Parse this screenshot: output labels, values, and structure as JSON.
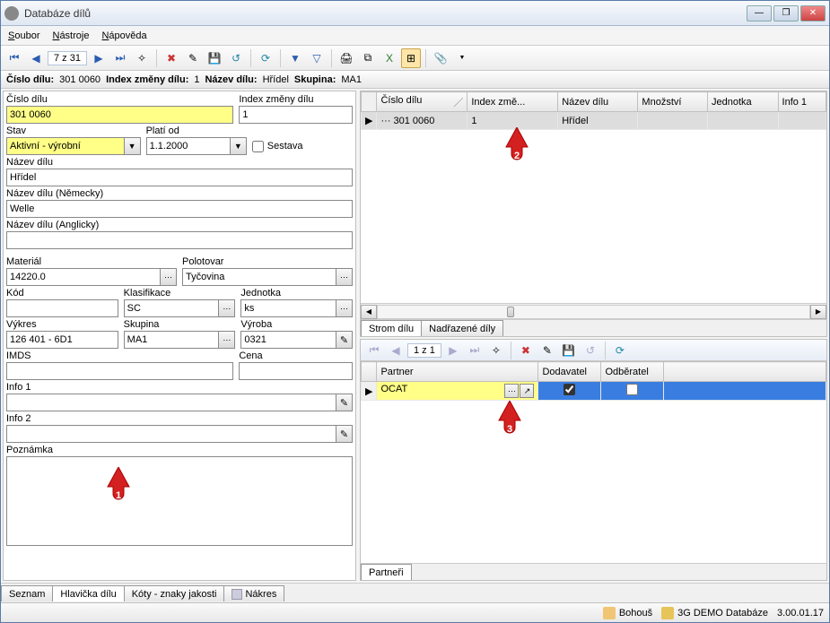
{
  "window": {
    "title": "Databáze dílů"
  },
  "menubar": {
    "soubor": "Soubor",
    "nastroje": "Nástroje",
    "napoveda": "Nápověda"
  },
  "toolbar": {
    "nav_count": "7 z 31"
  },
  "infobar": {
    "cislo_dilu_lbl": "Číslo dílu:",
    "cislo_dilu_val": "301 0060",
    "index_lbl": "Index změny dílu:",
    "index_val": "1",
    "nazev_lbl": "Název dílu:",
    "nazev_val": "Hřídel",
    "skupina_lbl": "Skupina:",
    "skupina_val": "MA1"
  },
  "form": {
    "cislo_dilu_lbl": "Číslo dílu",
    "cislo_dilu": "301 0060",
    "index_lbl": "Index změny dílu",
    "index": "1",
    "stav_lbl": "Stav",
    "stav": "Aktivní - výrobní",
    "plati_od_lbl": "Platí od",
    "plati_od": "1.1.2000",
    "sestava_lbl": "Sestava",
    "nazev_lbl": "Název dílu",
    "nazev": "Hřídel",
    "nazev_de_lbl": "Název dílu (Německy)",
    "nazev_de": "Welle",
    "nazev_en_lbl": "Název dílu (Anglicky)",
    "nazev_en": "",
    "material_lbl": "Materiál",
    "material": "14220.0",
    "polotovar_lbl": "Polotovar",
    "polotovar": "Tyčovina",
    "kod_lbl": "Kód",
    "kod": "",
    "klasifikace_lbl": "Klasifikace",
    "klasifikace": "SC",
    "jednotka_lbl": "Jednotka",
    "jednotka": "ks",
    "vykres_lbl": "Výkres",
    "vykres": "126 401 - 6D1",
    "skupina_lbl": "Skupina",
    "skupina": "MA1",
    "vyroba_lbl": "Výroba",
    "vyroba": "0321",
    "imds_lbl": "IMDS",
    "imds": "",
    "cena_lbl": "Cena",
    "cena": "",
    "info1_lbl": "Info 1",
    "info1": "",
    "info2_lbl": "Info 2",
    "info2": "",
    "poznamka_lbl": "Poznámka",
    "poznamka": ""
  },
  "tree_grid": {
    "cols": {
      "cislo": "Číslo dílu",
      "index": "Index změ...",
      "nazev": "Název dílu",
      "mnozstvi": "Množství",
      "jednotka": "Jednotka",
      "info1": "Info 1"
    },
    "row": {
      "cislo": "··· 301 0060",
      "index": "1",
      "nazev": "Hřídel",
      "mnozstvi": "",
      "jednotka": "",
      "info1": ""
    }
  },
  "tree_tabs": {
    "strom": "Strom dílu",
    "nadrazene": "Nadřazené díly"
  },
  "partners": {
    "nav_count": "1 z 1",
    "cols": {
      "partner": "Partner",
      "dodavatel": "Dodavatel",
      "odberatel": "Odběratel"
    },
    "row": {
      "partner": "OCAT"
    },
    "tab": "Partneři"
  },
  "bottom_tabs": {
    "seznam": "Seznam",
    "hlavicka": "Hlavička dílu",
    "koty": "Kóty - znaky jakosti",
    "nakres": "Nákres"
  },
  "statusbar": {
    "user": "Bohouš",
    "db": "3G DEMO Databáze",
    "ver": "3.00.01.17"
  },
  "markers": {
    "m1": "1",
    "m2": "2",
    "m3": "3"
  }
}
